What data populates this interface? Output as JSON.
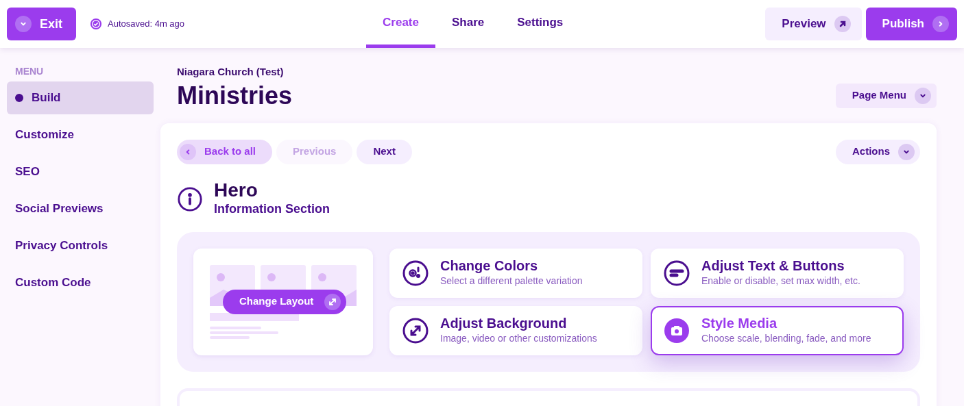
{
  "topbar": {
    "exit": "Exit",
    "autosave": "Autosaved: 4m ago",
    "tabs": [
      {
        "label": "Create",
        "selected": true
      },
      {
        "label": "Share",
        "selected": false
      },
      {
        "label": "Settings",
        "selected": false
      }
    ],
    "preview": "Preview",
    "publish": "Publish"
  },
  "sidebar": {
    "heading": "MENU",
    "items": [
      {
        "label": "Build",
        "selected": true
      },
      {
        "label": "Customize",
        "selected": false
      },
      {
        "label": "SEO",
        "selected": false
      },
      {
        "label": "Social Previews",
        "selected": false
      },
      {
        "label": "Privacy Controls",
        "selected": false
      },
      {
        "label": "Custom Code",
        "selected": false
      }
    ]
  },
  "page": {
    "site": "Niagara Church (Test)",
    "title": "Ministries",
    "page_menu": "Page Menu"
  },
  "section": {
    "back": "Back to all",
    "previous": {
      "label": "Previous",
      "disabled": true
    },
    "next": {
      "label": "Next",
      "disabled": false
    },
    "actions": "Actions",
    "title": "Hero",
    "subtitle": "Information Section",
    "layout_button": "Change Layout",
    "options": [
      {
        "kind": "colors",
        "title": "Change Colors",
        "description": "Select a different palette variation",
        "selected": false
      },
      {
        "kind": "text",
        "title": "Adjust Text & Buttons",
        "description": "Enable or disable, set max width, etc.",
        "selected": false
      },
      {
        "kind": "background",
        "title": "Adjust Background",
        "description": "Image, video or other customizations",
        "selected": false
      },
      {
        "kind": "media",
        "title": "Style Media",
        "description": "Choose scale, blending, fade, and more",
        "selected": true
      }
    ]
  }
}
